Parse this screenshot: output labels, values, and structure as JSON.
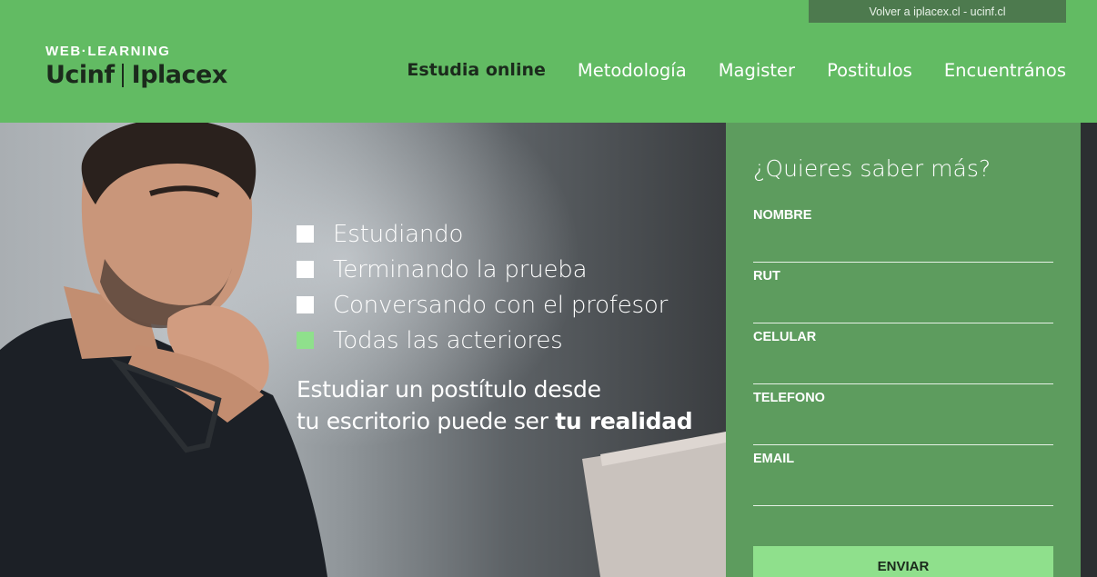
{
  "topbar": {
    "link_text": "Volver a iplacex.cl - ucinf.cl"
  },
  "logo": {
    "tagline": "WEB·LEARNING",
    "brand_left": "Ucinf",
    "brand_right": "Iplacex"
  },
  "nav": {
    "items": [
      {
        "label": "Estudia online",
        "active": true
      },
      {
        "label": "Metodología"
      },
      {
        "label": "Magister"
      },
      {
        "label": "Postitulos"
      },
      {
        "label": "Encuentrános"
      }
    ]
  },
  "hero": {
    "checklist": [
      {
        "label": "Estudiando",
        "color": "#ffffff"
      },
      {
        "label": "Terminando la prueba",
        "color": "#ffffff"
      },
      {
        "label": "Conversando con el profesor",
        "color": "#ffffff"
      },
      {
        "label": "Todas las acteriores",
        "color": "#8fe08c"
      }
    ],
    "tagline_line1": "Estudiar un postítulo desde",
    "tagline_line2": "tu escritorio puede ser",
    "tagline_bold": "tu realidad"
  },
  "form": {
    "title": "¿Quieres saber más?",
    "fields": [
      {
        "label": "NOMBRE",
        "value": ""
      },
      {
        "label": "RUT",
        "value": ""
      },
      {
        "label": "CELULAR",
        "value": ""
      },
      {
        "label": "TELEFONO",
        "value": ""
      },
      {
        "label": "EMAIL",
        "value": ""
      }
    ],
    "submit_label": "ENVIAR"
  },
  "colors": {
    "header_green": "#62bb63",
    "form_green": "#5d9c5e",
    "accent_light_green": "#8fe08c",
    "topbar_dark_green": "#4d7a4e",
    "dark_text": "#1b2a1c"
  }
}
